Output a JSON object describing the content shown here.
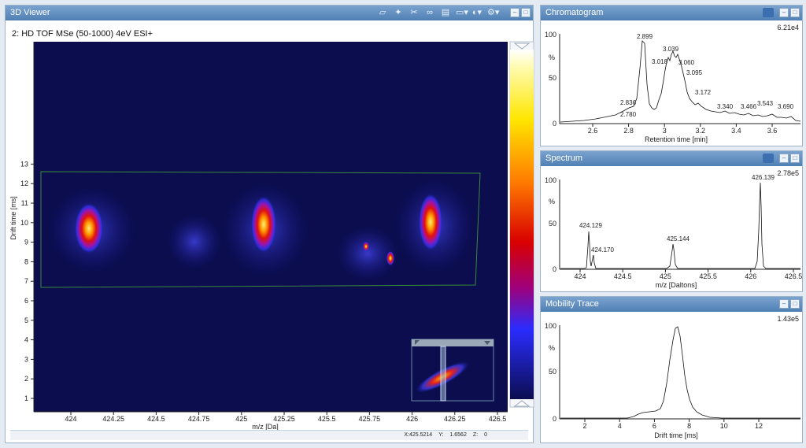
{
  "viewer": {
    "title": "3D Viewer",
    "dataset": "2: HD TOF MSe (50-1000) 4eV ESI+",
    "x_axis_label": "m/z [Da]",
    "y_axis_label": "Drift time [ms]",
    "x_ticks": [
      "424",
      "424.25",
      "424.5",
      "424.75",
      "425",
      "425.25",
      "425.5",
      "425.75",
      "426",
      "426.25",
      "426.5"
    ],
    "y_ticks": [
      "1",
      "2",
      "3",
      "4",
      "5",
      "6",
      "7",
      "8",
      "9",
      "10",
      "11",
      "12",
      "13"
    ],
    "status": {
      "x": "X:425.5214",
      "y": "Y:",
      "y_value": "1.6562",
      "z": "Z:",
      "z_value": "0"
    },
    "toolbar_icons": [
      "cube-icon",
      "pin-icon",
      "scissors-icon",
      "link-icon",
      "document-icon",
      "display-icon",
      "gauge-icon",
      "settings-icon"
    ],
    "colors": {
      "plot_bg": "#0b0d4f",
      "selection_box": "#3a8a3a"
    }
  },
  "chromatogram": {
    "title": "Chromatogram",
    "intensity": "6.21e4",
    "y_ticks": [
      "100",
      "%",
      "50",
      "0"
    ],
    "x_ticks": [
      "2.6",
      "2.8",
      "3",
      "3.2",
      "3.4",
      "3.6"
    ],
    "x_axis_label": "Retention time [min]",
    "peak_labels": [
      "2.780",
      "2.836",
      "2.899",
      "3.018",
      "3.039",
      "3.060",
      "3.095",
      "3.172",
      "3.340",
      "3.466",
      "3.543",
      "3.690"
    ]
  },
  "spectrum": {
    "title": "Spectrum",
    "intensity": "2.78e5",
    "y_ticks": [
      "100",
      "%",
      "50",
      "0"
    ],
    "x_ticks": [
      "424",
      "424.5",
      "425",
      "425.5",
      "426",
      "426.5"
    ],
    "x_axis_label": "m/z [Daltons]",
    "peak_labels": [
      "424.129",
      "424.170",
      "425.144",
      "426.139"
    ]
  },
  "mobility": {
    "title": "Mobility Trace",
    "intensity": "1.43e5",
    "y_ticks": [
      "100",
      "%",
      "50",
      "0"
    ],
    "x_ticks": [
      "2",
      "4",
      "6",
      "8",
      "10",
      "12"
    ],
    "x_axis_label": "Drift time [ms]"
  }
}
